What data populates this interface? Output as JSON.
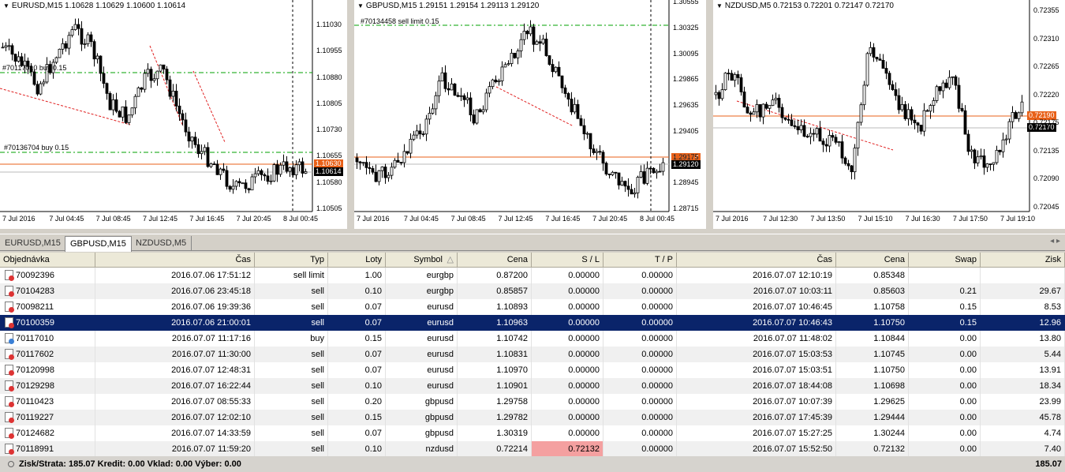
{
  "charts": [
    {
      "title": "EURUSD,M15  1.10628 1.10629 1.10600 1.10614",
      "yticks": [
        "1.11030",
        "1.10955",
        "1.10880",
        "1.10805",
        "1.10730",
        "1.10655",
        "1.10580",
        "1.10505"
      ],
      "xticks": [
        "7 Jul 2016",
        "7 Jul 04:45",
        "7 Jul 08:45",
        "7 Jul 12:45",
        "7 Jul 16:45",
        "7 Jul 20:45",
        "8 Jul 00:45"
      ],
      "ask": "1.10630",
      "bid": "1.10614",
      "orders": [
        "#70117010 buy 0.15",
        "#70136704 buy 0.15"
      ]
    },
    {
      "title": "GBPUSD,M15  1.29151 1.29154 1.29113 1.29120",
      "yticks": [
        "1.30555",
        "1.30325",
        "1.30095",
        "1.29865",
        "1.29635",
        "1.29405",
        "1.29175",
        "1.28945",
        "1.28715"
      ],
      "xticks": [
        "7 Jul 2016",
        "7 Jul 04:45",
        "7 Jul 08:45",
        "7 Jul 12:45",
        "7 Jul 16:45",
        "7 Jul 20:45",
        "8 Jul 00:45"
      ],
      "ask": "1.29178",
      "bid": "1.29120",
      "orders": [
        "#70134458 sell limit 0.15"
      ]
    },
    {
      "title": "NZDUSD,M5  0.72153 0.72201 0.72147 0.72170",
      "yticks": [
        "0.72355",
        "0.72310",
        "0.72265",
        "0.72220",
        "0.72175",
        "0.72135",
        "0.72090",
        "0.72045"
      ],
      "xticks": [
        "7 Jul 2016",
        "7 Jul 12:30",
        "7 Jul 13:50",
        "7 Jul 15:10",
        "7 Jul 16:30",
        "7 Jul 17:50",
        "7 Jul 19:10"
      ],
      "ask": "0.72190",
      "bid": "0.72170",
      "orders": []
    }
  ],
  "chart_tabs": [
    "EURUSD,M15",
    "GBPUSD,M15",
    "NZDUSD,M5"
  ],
  "active_tab": 1,
  "tab_arrows": "◂ ▸",
  "table": {
    "headers": [
      "Objednávka",
      "Čas",
      "Typ",
      "Loty",
      "Symbol",
      "Cena",
      "S / L",
      "T / P",
      "Čas",
      "Cena",
      "Swap",
      "Zisk"
    ],
    "sort_indicator": "△",
    "rows": [
      [
        "70092396",
        "2016.07.06 17:51:12",
        "sell limit",
        "1.00",
        "eurgbp",
        "0.87200",
        "0.00000",
        "0.00000",
        "2016.07.07 12:10:19",
        "0.85348",
        "",
        ""
      ],
      [
        "70104283",
        "2016.07.06 23:45:18",
        "sell",
        "0.10",
        "eurgbp",
        "0.85857",
        "0.00000",
        "0.00000",
        "2016.07.07 10:03:11",
        "0.85603",
        "0.21",
        "29.67"
      ],
      [
        "70098211",
        "2016.07.06 19:39:36",
        "sell",
        "0.07",
        "eurusd",
        "1.10893",
        "0.00000",
        "0.00000",
        "2016.07.07 10:46:45",
        "1.10758",
        "0.15",
        "8.53"
      ],
      [
        "70100359",
        "2016.07.06 21:00:01",
        "sell",
        "0.07",
        "eurusd",
        "1.10963",
        "0.00000",
        "0.00000",
        "2016.07.07 10:46:43",
        "1.10750",
        "0.15",
        "12.96"
      ],
      [
        "70117010",
        "2016.07.07 11:17:16",
        "buy",
        "0.15",
        "eurusd",
        "1.10742",
        "0.00000",
        "0.00000",
        "2016.07.07 11:48:02",
        "1.10844",
        "0.00",
        "13.80"
      ],
      [
        "70117602",
        "2016.07.07 11:30:00",
        "sell",
        "0.07",
        "eurusd",
        "1.10831",
        "0.00000",
        "0.00000",
        "2016.07.07 15:03:53",
        "1.10745",
        "0.00",
        "5.44"
      ],
      [
        "70120998",
        "2016.07.07 12:48:31",
        "sell",
        "0.07",
        "eurusd",
        "1.10970",
        "0.00000",
        "0.00000",
        "2016.07.07 15:03:51",
        "1.10750",
        "0.00",
        "13.91"
      ],
      [
        "70129298",
        "2016.07.07 16:22:44",
        "sell",
        "0.10",
        "eurusd",
        "1.10901",
        "0.00000",
        "0.00000",
        "2016.07.07 18:44:08",
        "1.10698",
        "0.00",
        "18.34"
      ],
      [
        "70110423",
        "2016.07.07 08:55:33",
        "sell",
        "0.20",
        "gbpusd",
        "1.29758",
        "0.00000",
        "0.00000",
        "2016.07.07 10:07:39",
        "1.29625",
        "0.00",
        "23.99"
      ],
      [
        "70119227",
        "2016.07.07 12:02:10",
        "sell",
        "0.15",
        "gbpusd",
        "1.29782",
        "0.00000",
        "0.00000",
        "2016.07.07 17:45:39",
        "1.29444",
        "0.00",
        "45.78"
      ],
      [
        "70124682",
        "2016.07.07 14:33:59",
        "sell",
        "0.07",
        "gbpusd",
        "1.30319",
        "0.00000",
        "0.00000",
        "2016.07.07 15:27:25",
        "1.30244",
        "0.00",
        "4.74"
      ],
      [
        "70118991",
        "2016.07.07 11:59:20",
        "sell",
        "0.10",
        "nzdusd",
        "0.72214",
        "0.72132",
        "0.00000",
        "2016.07.07 15:52:50",
        "0.72132",
        "0.00",
        "7.40"
      ]
    ],
    "selected_row": 3,
    "highlight_sl_row": 11
  },
  "totals": {
    "summary": "Zisk/Strata: 185.07  Kredit: 0.00  Vklad: 0.00  Výber: 0.00",
    "profit": "185.07"
  },
  "colors": {
    "selection": "#0a246a",
    "ask": "#e86018",
    "sl_highlight": "#f4a0a0",
    "buy_line": "#00a000",
    "trend": "#e02020"
  }
}
